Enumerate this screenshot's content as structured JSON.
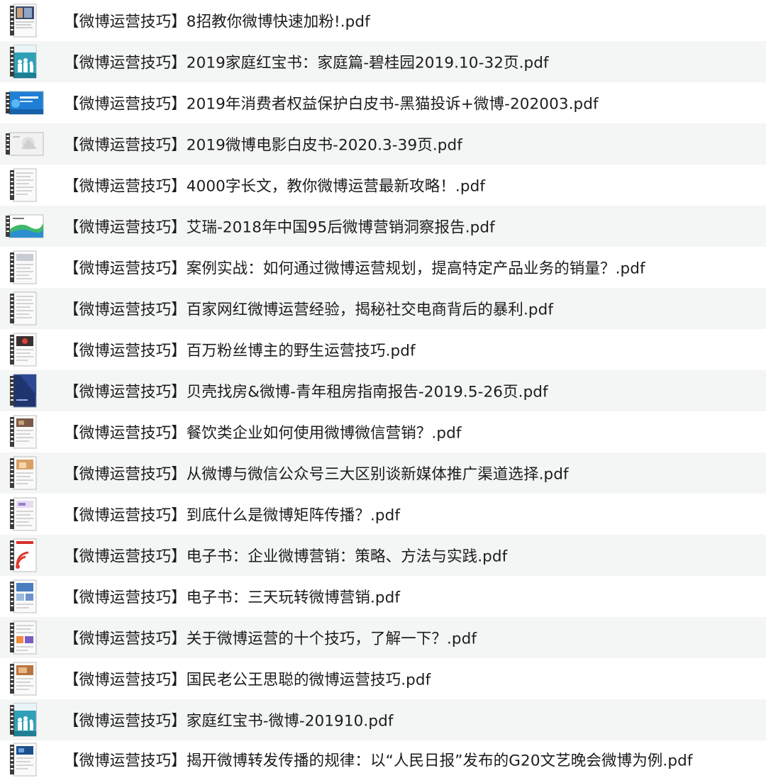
{
  "files": [
    {
      "name": "【微博运营技巧】8招教你微博快速加粉!.pdf",
      "thumb": "portrait-photo-icon"
    },
    {
      "name": "【微博运营技巧】2019家庭红宝书：家庭篇-碧桂园2019.10-32页.pdf",
      "thumb": "family-cover-icon"
    },
    {
      "name": "【微博运营技巧】2019年消费者权益保护白皮书-黑猫投诉+微博-202003.pdf",
      "thumb": "blue-landscape-icon"
    },
    {
      "name": "【微博运营技巧】2019微博电影白皮书-2020.3-39页.pdf",
      "thumb": "grey-landscape-icon"
    },
    {
      "name": "【微博运营技巧】4000字长文，教你微博运营最新攻略！.pdf",
      "thumb": "text-document-icon"
    },
    {
      "name": "【微博运营技巧】艾瑞-2018年中国95后微博营销洞察报告.pdf",
      "thumb": "green-landscape-icon"
    },
    {
      "name": "【微博运营技巧】案例实战：如何通过微博运营规划，提高特定产品业务的销量？.pdf",
      "thumb": "text-document-icon"
    },
    {
      "name": "【微博运营技巧】百家网红微博运营经验，揭秘社交电商背后的暴利.pdf",
      "thumb": "text-document-icon"
    },
    {
      "name": "【微博运营技巧】百万粉丝博主的野生运营技巧.pdf",
      "thumb": "red-photo-document-icon"
    },
    {
      "name": "【微博运营技巧】贝壳找房&微博-青年租房指南报告-2019.5-26页.pdf",
      "thumb": "navy-cover-icon"
    },
    {
      "name": "【微博运营技巧】餐饮类企业如何使用微博微信营销？.pdf",
      "thumb": "photo-document-icon"
    },
    {
      "name": "【微博运营技巧】从微博与微信公众号三大区别谈新媒体推广渠道选择.pdf",
      "thumb": "warm-photo-document-icon"
    },
    {
      "name": "【微博运营技巧】到底什么是微博矩阵传播？.pdf",
      "thumb": "purple-document-icon"
    },
    {
      "name": "【微博运营技巧】电子书：企业微博营销：策略、方法与实践.pdf",
      "thumb": "red-cover-icon"
    },
    {
      "name": "【微博运营技巧】电子书：三天玩转微博营销.pdf",
      "thumb": "blue-photo-document-icon"
    },
    {
      "name": "【微博运营技巧】关于微博运营的十个技巧，了解一下？.pdf",
      "thumb": "colorful-document-icon"
    },
    {
      "name": "【微博运营技巧】国民老公王思聪的微博运营技巧.pdf",
      "thumb": "warm-photo-document-icon"
    },
    {
      "name": "【微博运营技巧】家庭红宝书-微博-201910.pdf",
      "thumb": "family-cover-icon"
    },
    {
      "name": "【微博运营技巧】揭开微博转发传播的规律：以“人民日报”发布的G20文艺晚会微博为例.pdf",
      "thumb": "dark-blue-document-icon"
    }
  ]
}
